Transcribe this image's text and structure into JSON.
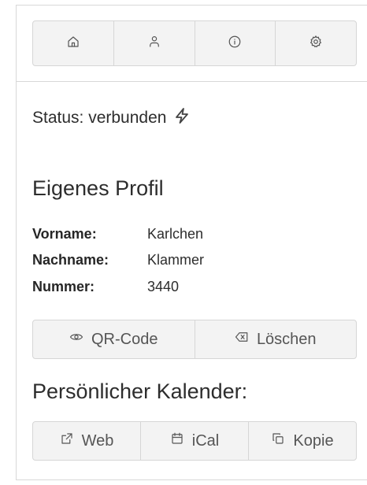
{
  "nav": {
    "home_icon": "home-icon",
    "profile_icon": "user-icon",
    "info_icon": "info-icon",
    "settings_icon": "gear-icon"
  },
  "status": {
    "text": "Status: verbunden",
    "icon": "lightning-icon"
  },
  "profile": {
    "heading": "Eigenes Profil",
    "fields": [
      {
        "label": "Vorname:",
        "value": "Karlchen"
      },
      {
        "label": "Nachname:",
        "value": "Klammer"
      },
      {
        "label": "Nummer:",
        "value": "3440"
      }
    ],
    "qr_label": "QR-Code",
    "delete_label": "Löschen"
  },
  "calendar": {
    "heading": "Persönlicher Kalender:",
    "web_label": "Web",
    "ical_label": "iCal",
    "copy_label": "Kopie"
  },
  "colors": {
    "button_bg": "#f3f3f3",
    "border": "#d6d6d6",
    "text": "#2d2d2d",
    "icon": "#555555"
  }
}
